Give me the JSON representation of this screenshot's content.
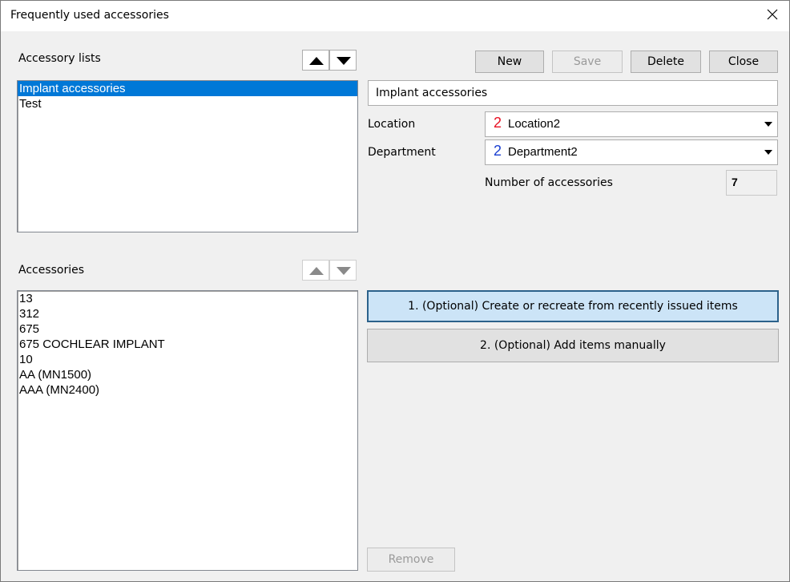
{
  "window": {
    "title": "Frequently used accessories"
  },
  "accessory_lists": {
    "label": "Accessory lists",
    "items": [
      "Implant accessories",
      "Test"
    ],
    "selected_index": 0
  },
  "toolbar": {
    "new_label": "New",
    "save_label": "Save",
    "delete_label": "Delete",
    "close_label": "Close"
  },
  "details": {
    "name_value": "Implant accessories",
    "location_label": "Location",
    "location_number": "2",
    "location_value": "Location2",
    "department_label": "Department",
    "department_number": "2",
    "department_value": "Department2",
    "count_label": "Number of accessories",
    "count_value": "7"
  },
  "accessories": {
    "label": "Accessories",
    "items": [
      "13",
      "312",
      "675",
      "675 COCHLEAR IMPLANT",
      "10",
      "AA (MN1500)",
      "AAA (MN2400)"
    ]
  },
  "actions": {
    "create_label": "1. (Optional) Create or recreate from recently issued items",
    "add_manually_label": "2. (Optional) Add items manually",
    "remove_label": "Remove"
  },
  "colors": {
    "selection": "#0078d7",
    "location_number": "#e81123",
    "department_number": "#1a3fd1",
    "primary_border": "#2c628b"
  }
}
